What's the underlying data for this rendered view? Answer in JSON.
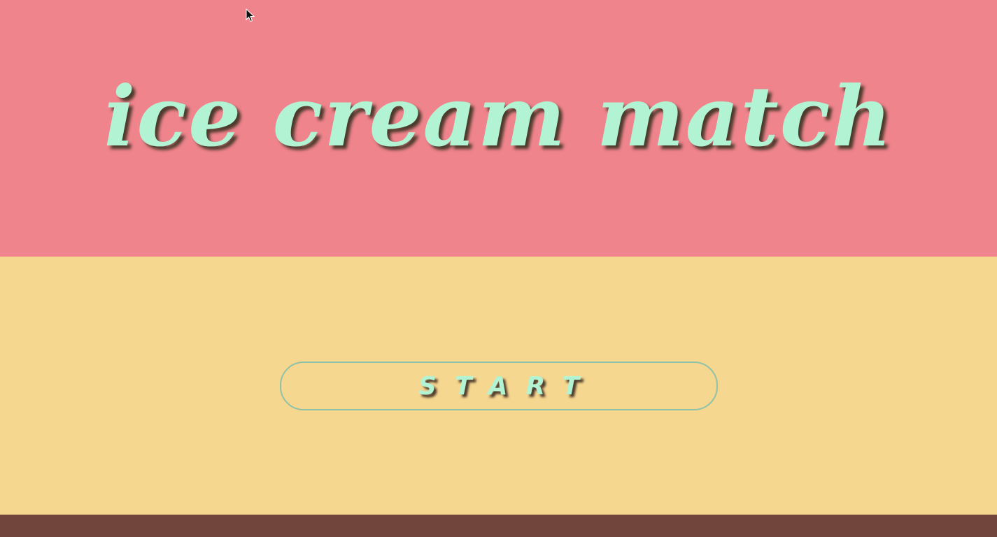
{
  "game": {
    "title": "ice cream match",
    "start_label": "START"
  },
  "colors": {
    "top_band": "#ef848c",
    "middle_band": "#f6d78f",
    "bottom_band": "#71453c",
    "title_text": "#b2f3d4",
    "text_shadow": "#4c3a2c",
    "button_border": "#8fc2a8"
  },
  "icons": {
    "cursor": "mouse-pointer-icon"
  }
}
